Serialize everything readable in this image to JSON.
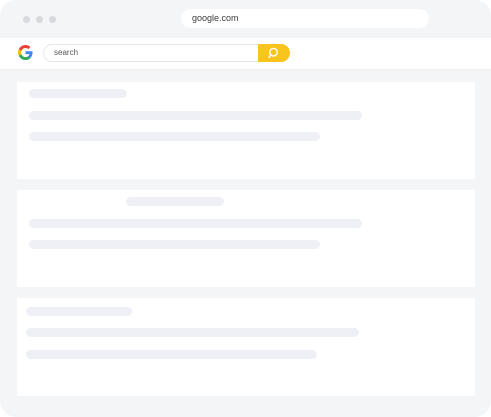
{
  "browser": {
    "address": "google.com",
    "window_dots": [
      "dot",
      "dot",
      "dot"
    ]
  },
  "toolbar": {
    "logo": "google-logo",
    "search_placeholder": "search",
    "search_button_icon": "search-icon"
  },
  "colors": {
    "window_bg": "#f4f5f7",
    "card_bg": "#ffffff",
    "placeholder_bar": "#eef0f5",
    "search_button": "#f9c51c",
    "google_blue": "#4285F4",
    "google_red": "#EA4335",
    "google_yellow": "#FBBC05",
    "google_green": "#34A853"
  },
  "results": [
    {
      "name": "result-card-1",
      "lines": 3
    },
    {
      "name": "result-card-2",
      "lines": 3
    },
    {
      "name": "result-card-3",
      "lines": 3
    }
  ]
}
